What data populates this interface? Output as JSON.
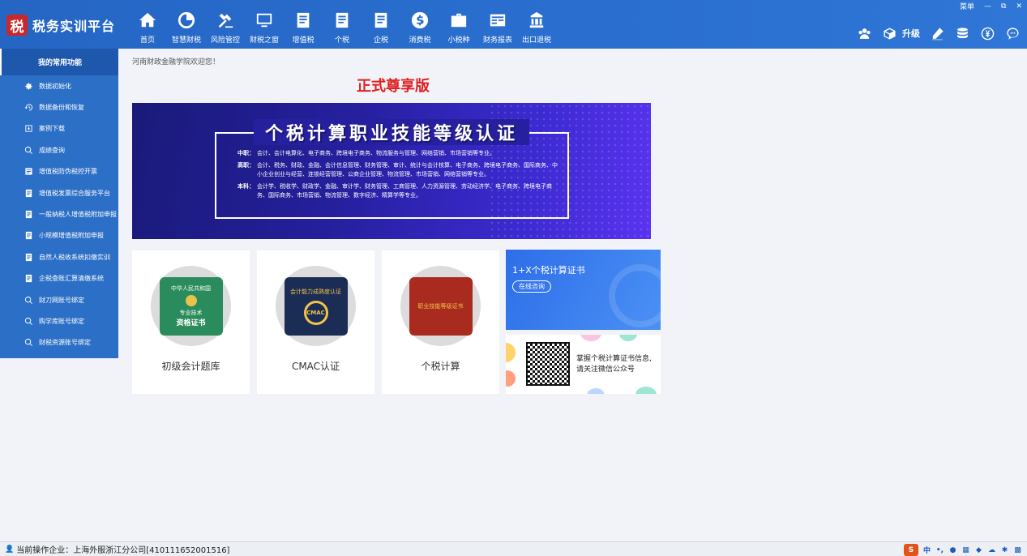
{
  "app": {
    "logo_char": "税",
    "title": "税务实训平台"
  },
  "window": {
    "menu_label": "菜单",
    "minimize": "—",
    "maximize": "⧉",
    "close": "✕"
  },
  "nav": [
    {
      "label": "首页",
      "icon": "home-icon"
    },
    {
      "label": "智慧财税",
      "icon": "pie-chart-icon"
    },
    {
      "label": "风险管控",
      "icon": "gavel-icon"
    },
    {
      "label": "财税之窗",
      "icon": "monitor-icon"
    },
    {
      "label": "增值税",
      "icon": "document-icon"
    },
    {
      "label": "个税",
      "icon": "document-icon"
    },
    {
      "label": "企税",
      "icon": "document-icon"
    },
    {
      "label": "消费税",
      "icon": "dollar-coin-icon"
    },
    {
      "label": "小税种",
      "icon": "briefcase-icon"
    },
    {
      "label": "财务报表",
      "icon": "report-icon"
    },
    {
      "label": "出口退税",
      "icon": "building-icon"
    }
  ],
  "toolbar": {
    "upgrade_label": "升级"
  },
  "sidebar": {
    "title": "我的常用功能",
    "items": [
      {
        "label": "数据初始化",
        "icon": "gear-icon"
      },
      {
        "label": "数据备份和恢复",
        "icon": "history-icon"
      },
      {
        "label": "案例下载",
        "icon": "download-icon"
      },
      {
        "label": "成绩查询",
        "icon": "search-icon"
      },
      {
        "label": "增值税防伪税控开票",
        "icon": "invoice-icon"
      },
      {
        "label": "增值税发票综合服务平台",
        "icon": "document-icon"
      },
      {
        "label": "一般纳税人增值税附加申报",
        "icon": "document-icon"
      },
      {
        "label": "小规模增值税附加申报",
        "icon": "document-icon"
      },
      {
        "label": "自然人税收系统扣缴实训",
        "icon": "document-icon"
      },
      {
        "label": "企税查账汇算清缴系统",
        "icon": "document-icon"
      },
      {
        "label": "财刀网账号绑定",
        "icon": "search-icon"
      },
      {
        "label": "购学库账号绑定",
        "icon": "search-icon"
      },
      {
        "label": "财税资源账号绑定",
        "icon": "search-icon"
      }
    ]
  },
  "main": {
    "welcome": "河南财政金融学院欢迎您！",
    "edition": "正式尊享版",
    "banner": {
      "title": "个税计算职业技能等级认证",
      "lines": [
        {
          "label": "中职：",
          "text": "会计、会计电算化、电子商务、跨境电子商务、物流服务与管理、网络营销、市场营销等专业。"
        },
        {
          "label": "高职：",
          "text": "会计、税务、财政、金融、会计信息管理、财务管理、审计、统计与会计核算、电子商务、跨境电子商务、国际商务、中小企业创业与经营、连锁经营管理、公商企业管理、物流管理、市场营销、网络营销等专业。"
        },
        {
          "label": "本科：",
          "text": "会计学、税收学、财政学、金融、审计学、财务管理、工商管理、人力资源管理、劳动经济学、电子商务、跨境电子商务、国际商务、市场营销、物流管理、数字经济、精算学等专业。"
        }
      ]
    },
    "cards": [
      {
        "label": "初级会计题库",
        "cert_top": "中华人民共和国",
        "cert_mid": "专业技术",
        "cert_bottom": "资格证书"
      },
      {
        "label": "CMAC认证",
        "cert_top": "会计能力成熟度认证",
        "cert_mid": "CMAC"
      },
      {
        "label": "个税计算",
        "cert_top": "职业技能等级证书"
      }
    ],
    "ad_blue": {
      "title": "1+X个税计算证书",
      "button": "在线咨询"
    },
    "ad_qr": {
      "line1": "掌握个税计算证书信息,",
      "line2": "请关注微信公众号"
    }
  },
  "status": {
    "text": "当前操作企业：上海外服浙江分公司[410111652001516]"
  },
  "colors": {
    "topbar": "#2a6fd0",
    "sidebar": "#2c6fc6",
    "edition": "#e02020",
    "banner": "#251f9c"
  }
}
